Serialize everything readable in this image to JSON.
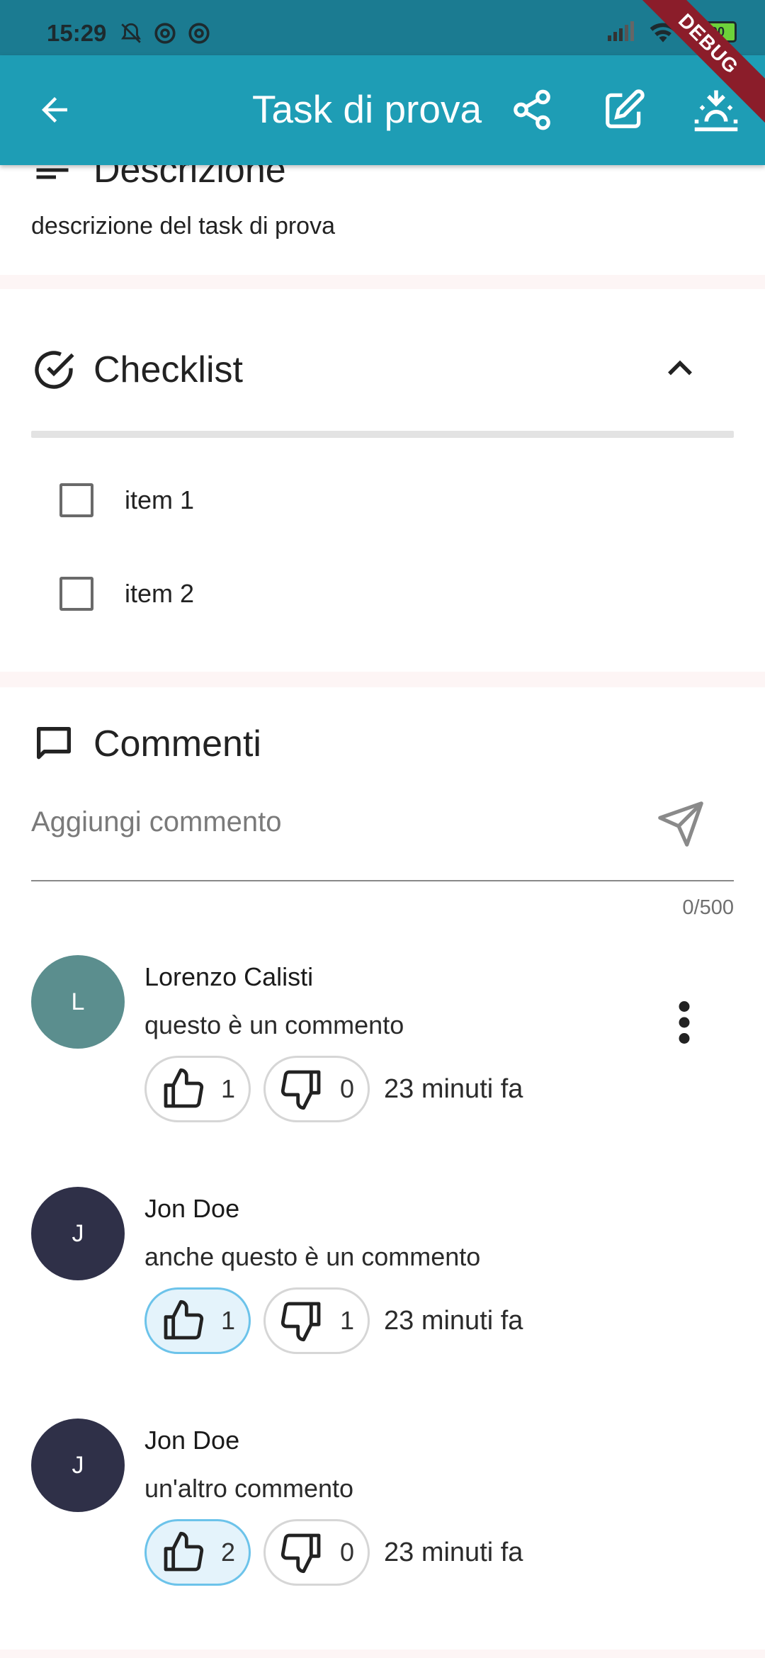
{
  "status_bar": {
    "time": "15:29",
    "battery": "100"
  },
  "debug_banner": "DEBUG",
  "app_bar": {
    "title": "Task di prova"
  },
  "description": {
    "title": "Descrizione",
    "text": "descrizione del task di prova"
  },
  "checklist": {
    "title": "Checklist",
    "items": [
      {
        "label": "item 1",
        "checked": false
      },
      {
        "label": "item 2",
        "checked": false
      }
    ]
  },
  "comments": {
    "title": "Commenti",
    "input_placeholder": "Aggiungi commento",
    "counter": "0/500",
    "list": [
      {
        "initial": "L",
        "author": "Lorenzo Calisti",
        "text": "questo è un commento",
        "likes": "1",
        "dislikes": "0",
        "time": "23 minuti fa",
        "liked": false,
        "avatar_color": "#5b8e8e"
      },
      {
        "initial": "J",
        "author": "Jon Doe",
        "text": "anche questo è un commento",
        "likes": "1",
        "dislikes": "1",
        "time": "23 minuti fa",
        "liked": true,
        "avatar_color": "#2f3048"
      },
      {
        "initial": "J",
        "author": "Jon Doe",
        "text": "un'altro commento",
        "likes": "2",
        "dislikes": "0",
        "time": "23 minuti fa",
        "liked": true,
        "avatar_color": "#2f3048"
      }
    ]
  }
}
